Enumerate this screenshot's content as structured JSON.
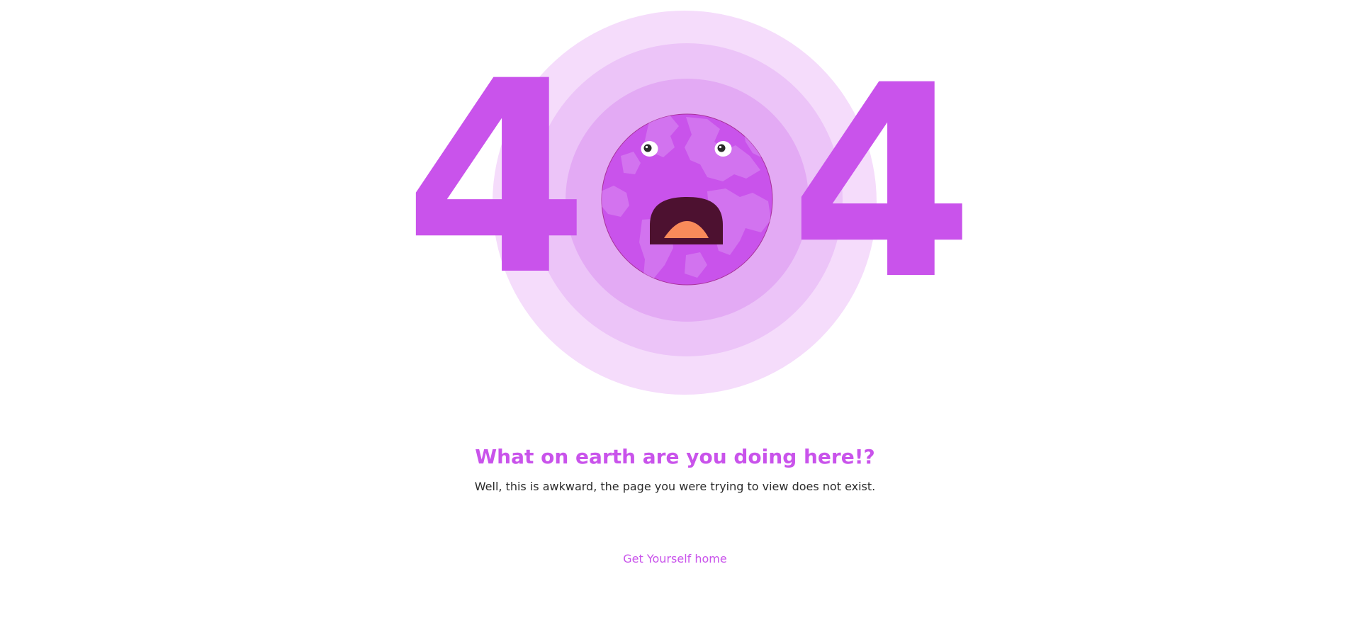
{
  "error": {
    "code_left_digit": "4",
    "code_right_digit": "4"
  },
  "globe": {
    "icon": "shocked-earth-face-icon"
  },
  "message": {
    "title": "What on earth are you doing here!?",
    "subtitle": "Well, this is awkward, the page you were trying to view does not exist."
  },
  "actions": {
    "home_link_label": "Get Yourself home"
  },
  "colors": {
    "accent": "#c953eb",
    "ring_outer": "#f5dcfb",
    "ring_mid": "#ecc4f8",
    "ring_inner": "#e3aaf4",
    "mouth": "#4d1130",
    "tongue": "#f98a5a",
    "body_text": "#2b2b2b"
  }
}
